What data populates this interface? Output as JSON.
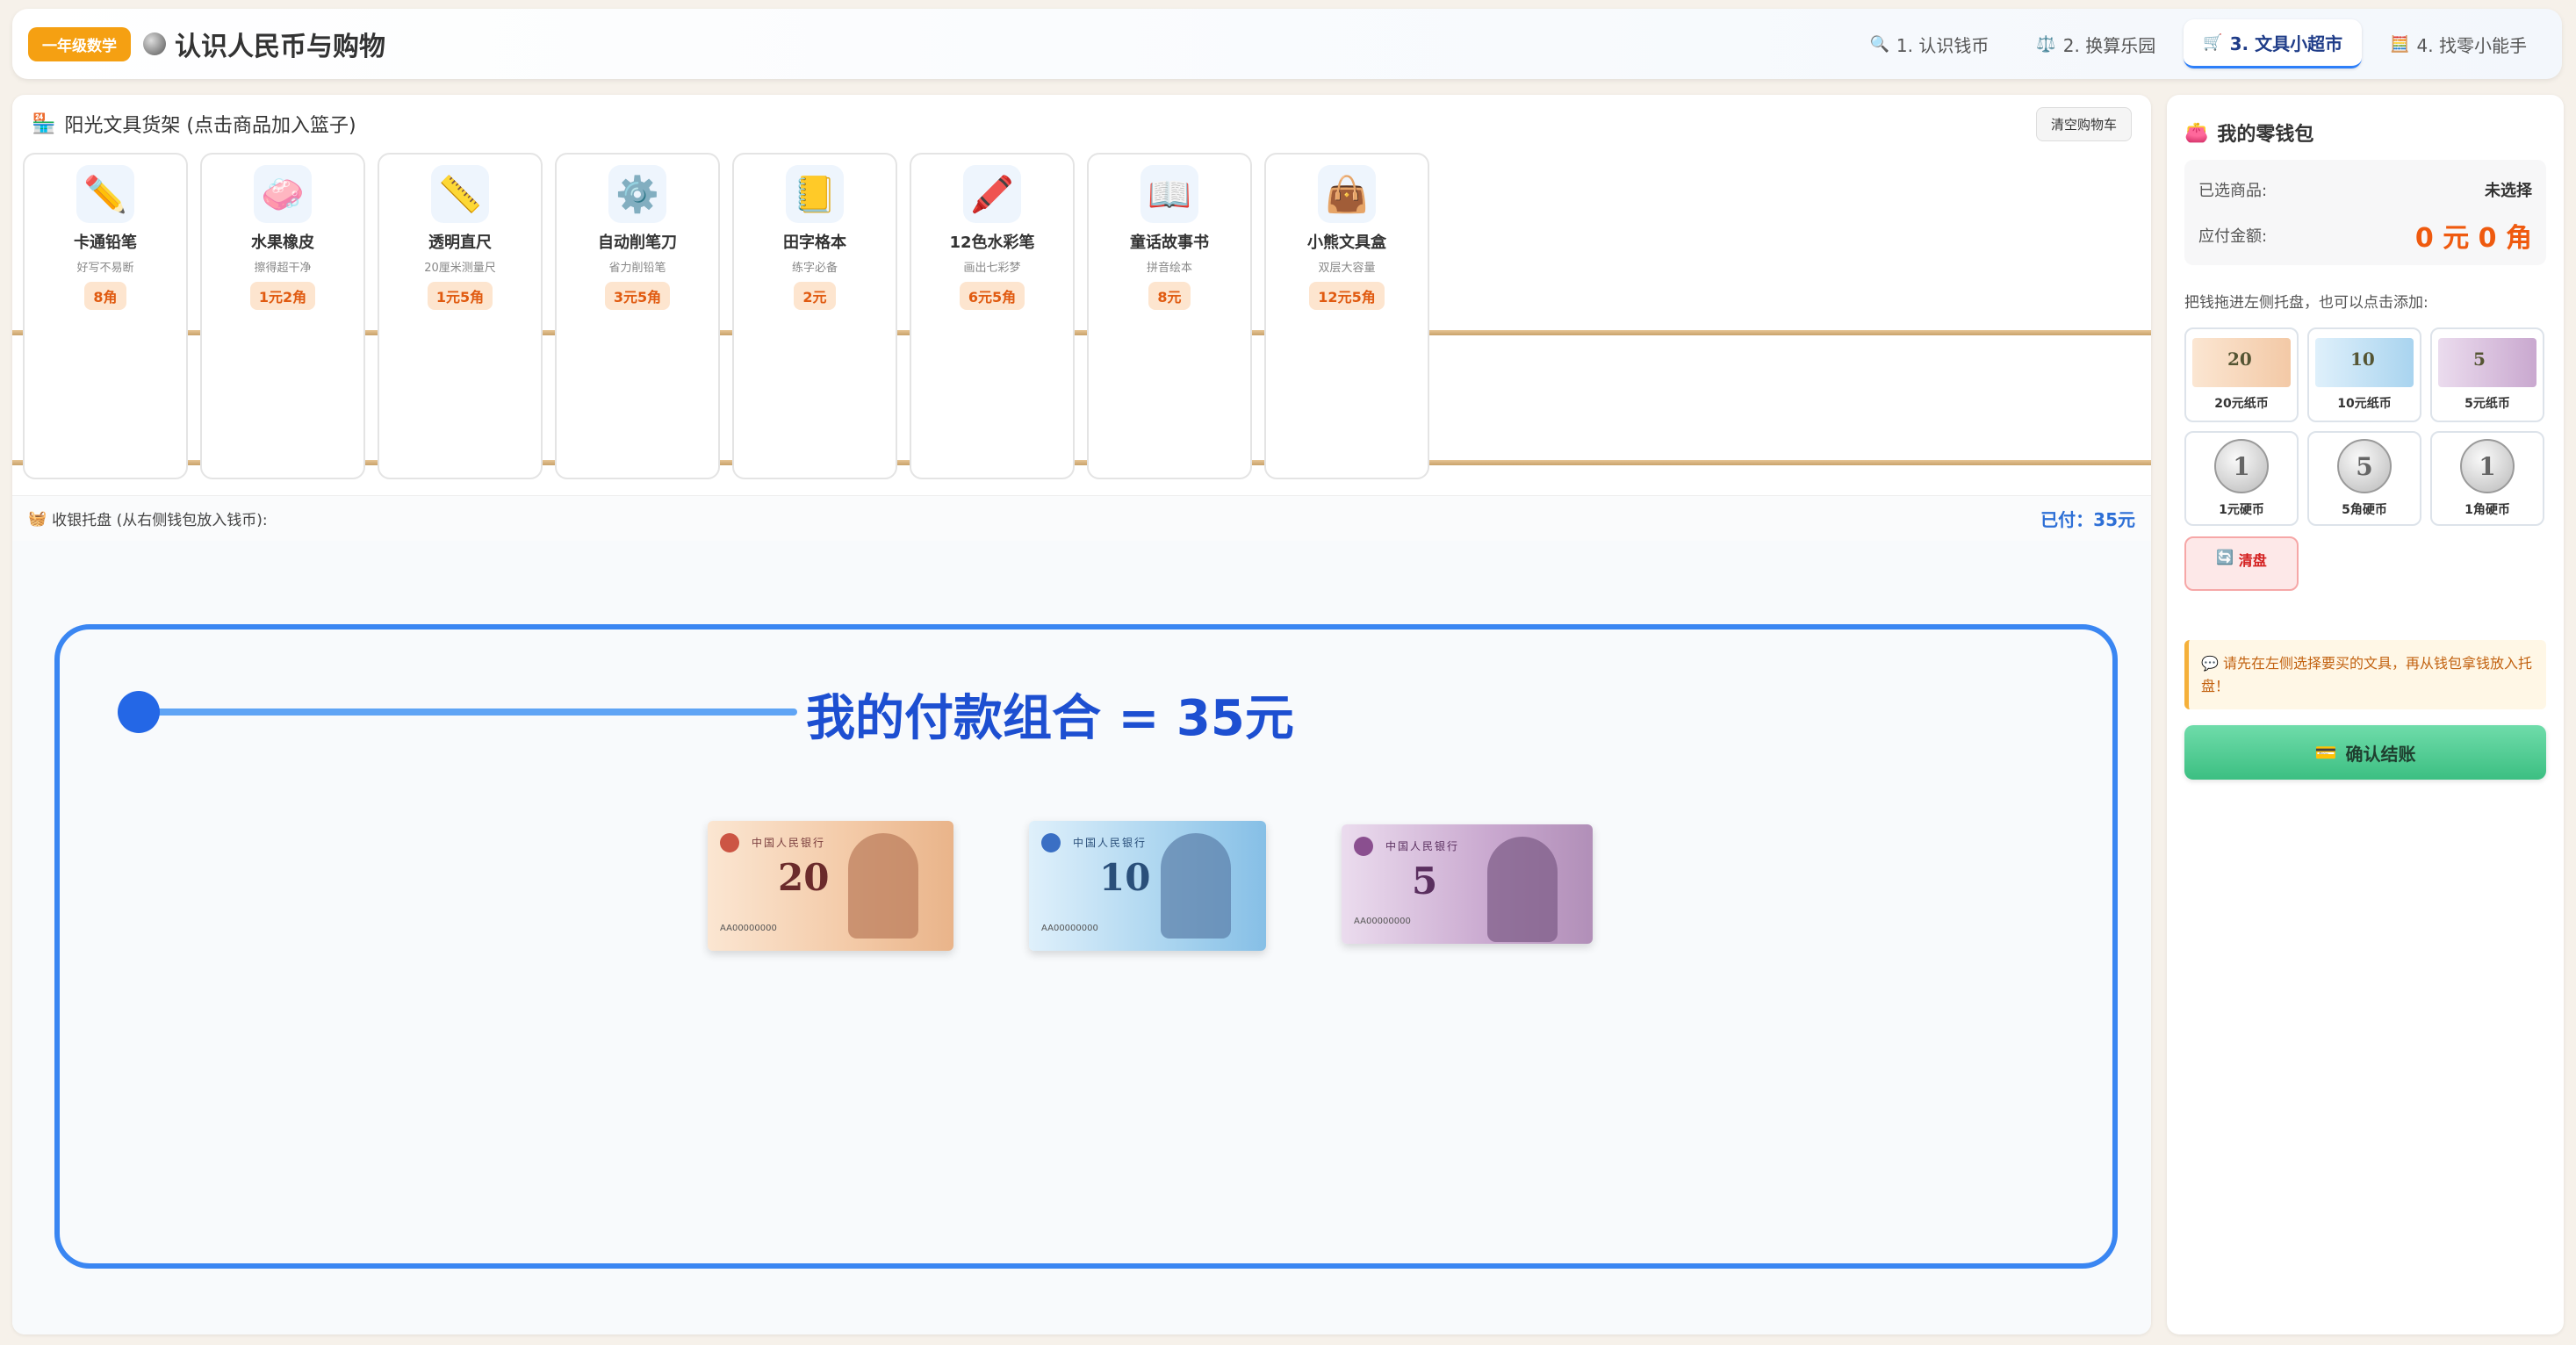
{
  "header": {
    "grade_badge": "一年级数学",
    "title": "认识人民币与购物",
    "tabs": [
      {
        "label": "1. 认识钱币",
        "icon": "🔍"
      },
      {
        "label": "2. 换算乐园",
        "icon": "⚖️"
      },
      {
        "label": "3. 文具小超市",
        "icon": "🛒"
      },
      {
        "label": "4. 找零小能手",
        "icon": "🧮"
      }
    ]
  },
  "shelf": {
    "title": "阳光文具货架 (点击商品加入篮子)",
    "clear_cart": "清空购物车",
    "products": [
      {
        "name": "卡通铅笔",
        "desc": "好写不易断",
        "price": "8角",
        "icon": "✏️"
      },
      {
        "name": "水果橡皮",
        "desc": "擦得超干净",
        "price": "1元2角",
        "icon": "🧼"
      },
      {
        "name": "透明直尺",
        "desc": "20厘米测量尺",
        "price": "1元5角",
        "icon": "📏"
      },
      {
        "name": "自动削笔刀",
        "desc": "省力削铅笔",
        "price": "3元5角",
        "icon": "⚙️"
      },
      {
        "name": "田字格本",
        "desc": "练字必备",
        "price": "2元",
        "icon": "📒"
      },
      {
        "name": "12色水彩笔",
        "desc": "画出七彩梦",
        "price": "6元5角",
        "icon": "🖍️"
      },
      {
        "name": "童话故事书",
        "desc": "拼音绘本",
        "price": "8元",
        "icon": "📖"
      },
      {
        "name": "小熊文具盒",
        "desc": "双层大容量",
        "price": "12元5角",
        "icon": "👜"
      }
    ]
  },
  "tray": {
    "title": "收银托盘 (从右侧钱包放入钱币):",
    "paid": "已付：35元",
    "combo_title": "我的付款组合 = 35元",
    "notes": [
      {
        "value": "20",
        "header": "中国人民银行",
        "serial": "AA00000000"
      },
      {
        "value": "10",
        "header": "中国人民银行",
        "serial": "AA00000000"
      },
      {
        "value": "5",
        "header": "中国人民银行",
        "serial": "AA00000000"
      }
    ]
  },
  "wallet": {
    "title": "我的零钱包",
    "selected_label": "已选商品:",
    "selected_value": "未选择",
    "due_label": "应付金额:",
    "due_value": "0 元 0 角",
    "drag_hint": "把钱拖进左侧托盘，也可以点击添加:",
    "money": [
      {
        "label": "20元纸币",
        "kind": "note",
        "value": "20"
      },
      {
        "label": "10元纸币",
        "kind": "note",
        "value": "10"
      },
      {
        "label": "5元纸币",
        "kind": "note",
        "value": "5"
      },
      {
        "label": "1元硬币",
        "kind": "coin",
        "value": "1"
      },
      {
        "label": "5角硬币",
        "kind": "coin",
        "value": "5"
      },
      {
        "label": "1角硬币",
        "kind": "coin",
        "value": "1"
      }
    ],
    "clear_tray": "清盘",
    "tip": "请先在左侧选择要买的文具，再从钱包拿钱放入托盘！",
    "confirm": "确认结账"
  },
  "colors": {
    "accent": "#3a86f2",
    "price": "#ef5a0f",
    "note20": "#f3c9a6",
    "note10": "#a9d4ef",
    "note5": "#c9a8cf"
  }
}
